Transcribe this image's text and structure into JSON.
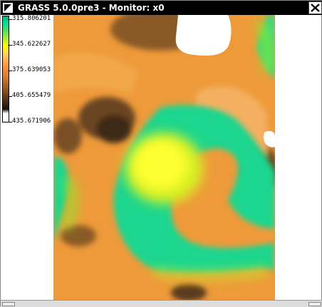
{
  "window": {
    "title": "GRASS 5.0.0pre3 - Monitor: x0"
  },
  "icons": {
    "menu": "window-menu-icon",
    "close": "close-x-icon"
  },
  "legend": {
    "labels": [
      "315.806201",
      "345.622627",
      "375.639053",
      "405.655479",
      "435.671906"
    ]
  },
  "colors": {
    "titlebar": "#000000",
    "low": "#00b37d",
    "mid_low": "#ffff00",
    "mid": "#ff9a40",
    "high": "#4d2f15",
    "peak": "#ffffff"
  }
}
